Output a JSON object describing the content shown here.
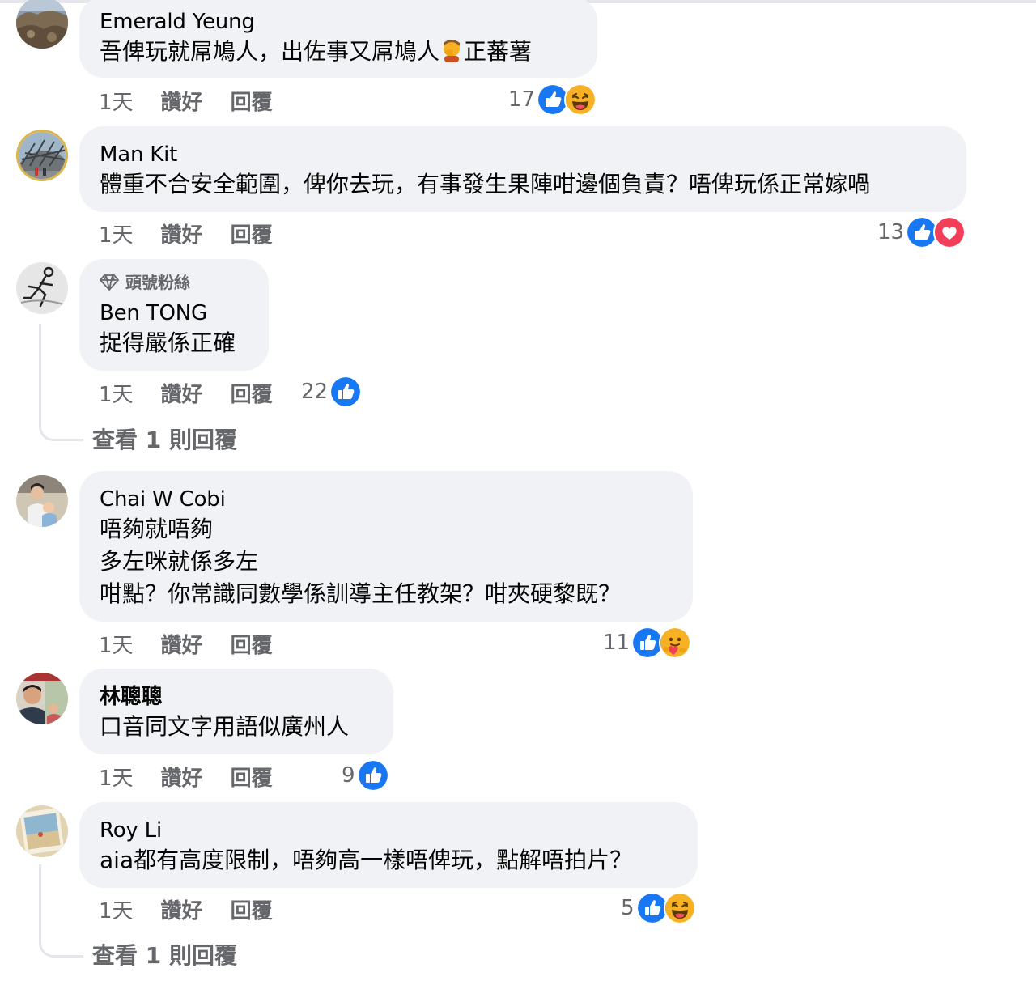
{
  "comments": [
    {
      "name": "Emerald Yeung",
      "lines": [
        "吾俾玩就屌鳩人，出佐事又屌鳩人",
        "正蕃薯"
      ],
      "emoji": "person-facepalming-emoji",
      "time": "1天",
      "like": "讚好",
      "reply": "回覆",
      "reaction_count": "17",
      "reactions": [
        "like-reaction-icon",
        "haha-reaction-icon"
      ]
    },
    {
      "name": "Man Kit",
      "lines": [
        "體重不合安全範圍，俾你去玩，有事發生果陣咁邊個負責？唔俾玩係正常嫁喎"
      ],
      "time": "1天",
      "like": "讚好",
      "reply": "回覆",
      "reaction_count": "13",
      "reactions": [
        "like-reaction-icon",
        "love-reaction-icon"
      ]
    },
    {
      "badge": "頭號粉絲",
      "name": "Ben TONG",
      "lines": [
        "捉得嚴係正確"
      ],
      "time": "1天",
      "like": "讚好",
      "reply": "回覆",
      "reaction_count": "22",
      "reactions": [
        "like-reaction-icon"
      ],
      "view_replies": "查看 1 則回覆"
    },
    {
      "name": "Chai W Cobi",
      "lines": [
        "唔夠就唔夠",
        "多左咪就係多左",
        "咁點？你常識同數學係訓導主任教架？咁夾硬黎既？"
      ],
      "time": "1天",
      "like": "讚好",
      "reply": "回覆",
      "reaction_count": "11",
      "reactions": [
        "like-reaction-icon",
        "care-reaction-icon"
      ]
    },
    {
      "name": "林聰聰",
      "lines": [
        "口音同文字用語似廣州人"
      ],
      "time": "1天",
      "like": "讚好",
      "reply": "回覆",
      "reaction_count": "9",
      "reactions": [
        "like-reaction-icon"
      ]
    },
    {
      "name": "Roy Li",
      "lines": [
        "aia都有高度限制，唔夠高一樣唔俾玩，點解唔拍片？"
      ],
      "time": "1天",
      "like": "讚好",
      "reply": "回覆",
      "reaction_count": "5",
      "reactions": [
        "like-reaction-icon",
        "haha-reaction-icon"
      ],
      "view_replies": "查看 1 則回覆"
    }
  ],
  "colors": {
    "bubble": "#f0f2f5",
    "secondary_text": "#65676b",
    "like_blue": "#1877f2",
    "love_red": "#f33e58",
    "haha_yellow": "#f7b125"
  }
}
